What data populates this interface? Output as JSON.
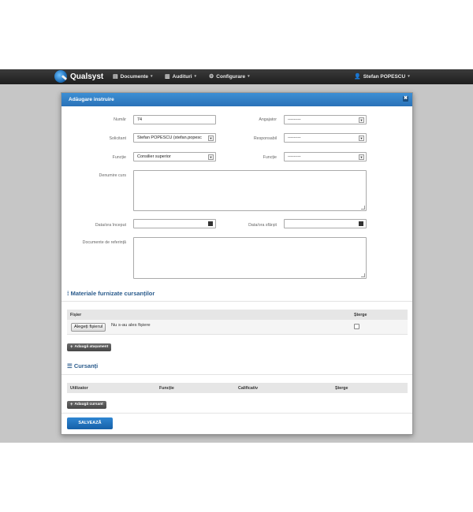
{
  "navbar": {
    "brand": "Qualsyst",
    "items": [
      {
        "label": "Documente",
        "icon": "document-icon"
      },
      {
        "label": "Audituri",
        "icon": "clipboard-icon"
      },
      {
        "label": "Configurare",
        "icon": "gear-icon"
      }
    ],
    "user": "Stefan POPESCU"
  },
  "modal": {
    "title": "Adăugare instruire",
    "close_glyph": "✖",
    "fields": {
      "numar": {
        "label": "Număr",
        "value": "74"
      },
      "angajator": {
        "label": "Angajator",
        "value": "---------"
      },
      "solicitant": {
        "label": "Solicitant",
        "value": "Stefan POPESCU (stefan.popesc"
      },
      "responsabil": {
        "label": "Responsabil",
        "value": "---------"
      },
      "functie1": {
        "label": "Funcție",
        "value": "Consilier superior"
      },
      "functie2": {
        "label": "Funcție",
        "value": "---------"
      },
      "denumire": {
        "label": "Denumire curs"
      },
      "data_inceput": {
        "label": "Data/ora început"
      },
      "data_sfarsit": {
        "label": "Data/ora sfârșit"
      },
      "documente": {
        "label": "Documente de referință"
      }
    },
    "materiale": {
      "title": "Materiale furnizate cursanților",
      "columns": [
        "Fișier",
        "Șterge"
      ],
      "file_button": "Alegeți fișierul",
      "file_status": "Nu s-au ales fișiere",
      "add_button": "Adaugă atașament"
    },
    "cursanti": {
      "title": "Cursanți",
      "columns": [
        "Utilizator",
        "Funcție",
        "Calificativ",
        "Șterge"
      ],
      "add_button": "Adaugă cursant"
    },
    "save_button": "SALVEAZĂ"
  },
  "colors": {
    "header_blue": "#2a72b8",
    "navbar": "#2a2a2a",
    "overlay": "#c6c6c6",
    "section_title": "#2a5b8c"
  }
}
